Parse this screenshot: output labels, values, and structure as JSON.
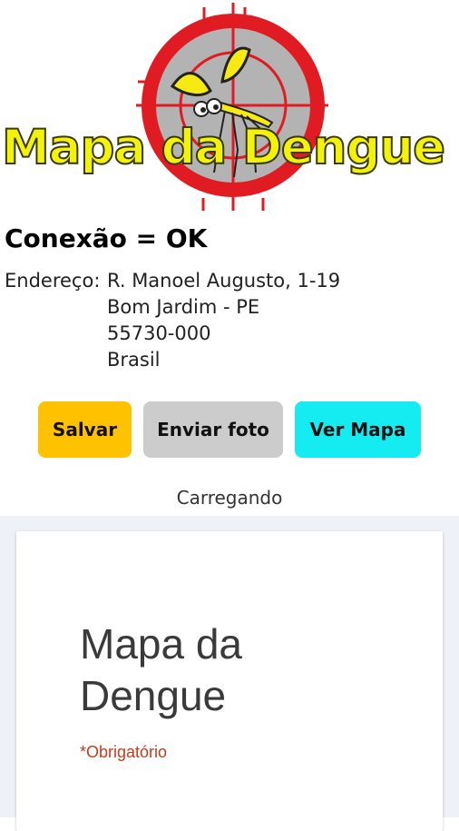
{
  "logo": {
    "text": "Mapa da Dengue",
    "colors": {
      "target_red": "#e11b22",
      "target_gray": "#b3b3b3",
      "text_yellow": "#f2f20a",
      "mosquito_yellow": "#f7ea13"
    }
  },
  "status": {
    "text": "Conexão = OK"
  },
  "address": {
    "label": "Endereço:",
    "lines": [
      "R. Manoel Augusto, 1-19",
      "Bom Jardim - PE",
      "55730-000",
      "Brasil"
    ]
  },
  "buttons": {
    "save": "Salvar",
    "send_photo": "Enviar foto",
    "view_map": "Ver Mapa"
  },
  "button_colors": {
    "save": "#ffc200",
    "send_photo": "#cccccc",
    "view_map": "#14ecf2"
  },
  "loading": {
    "text": "Carregando"
  },
  "form": {
    "title": "Mapa da Dengue",
    "required_note": "*Obrigatório"
  }
}
